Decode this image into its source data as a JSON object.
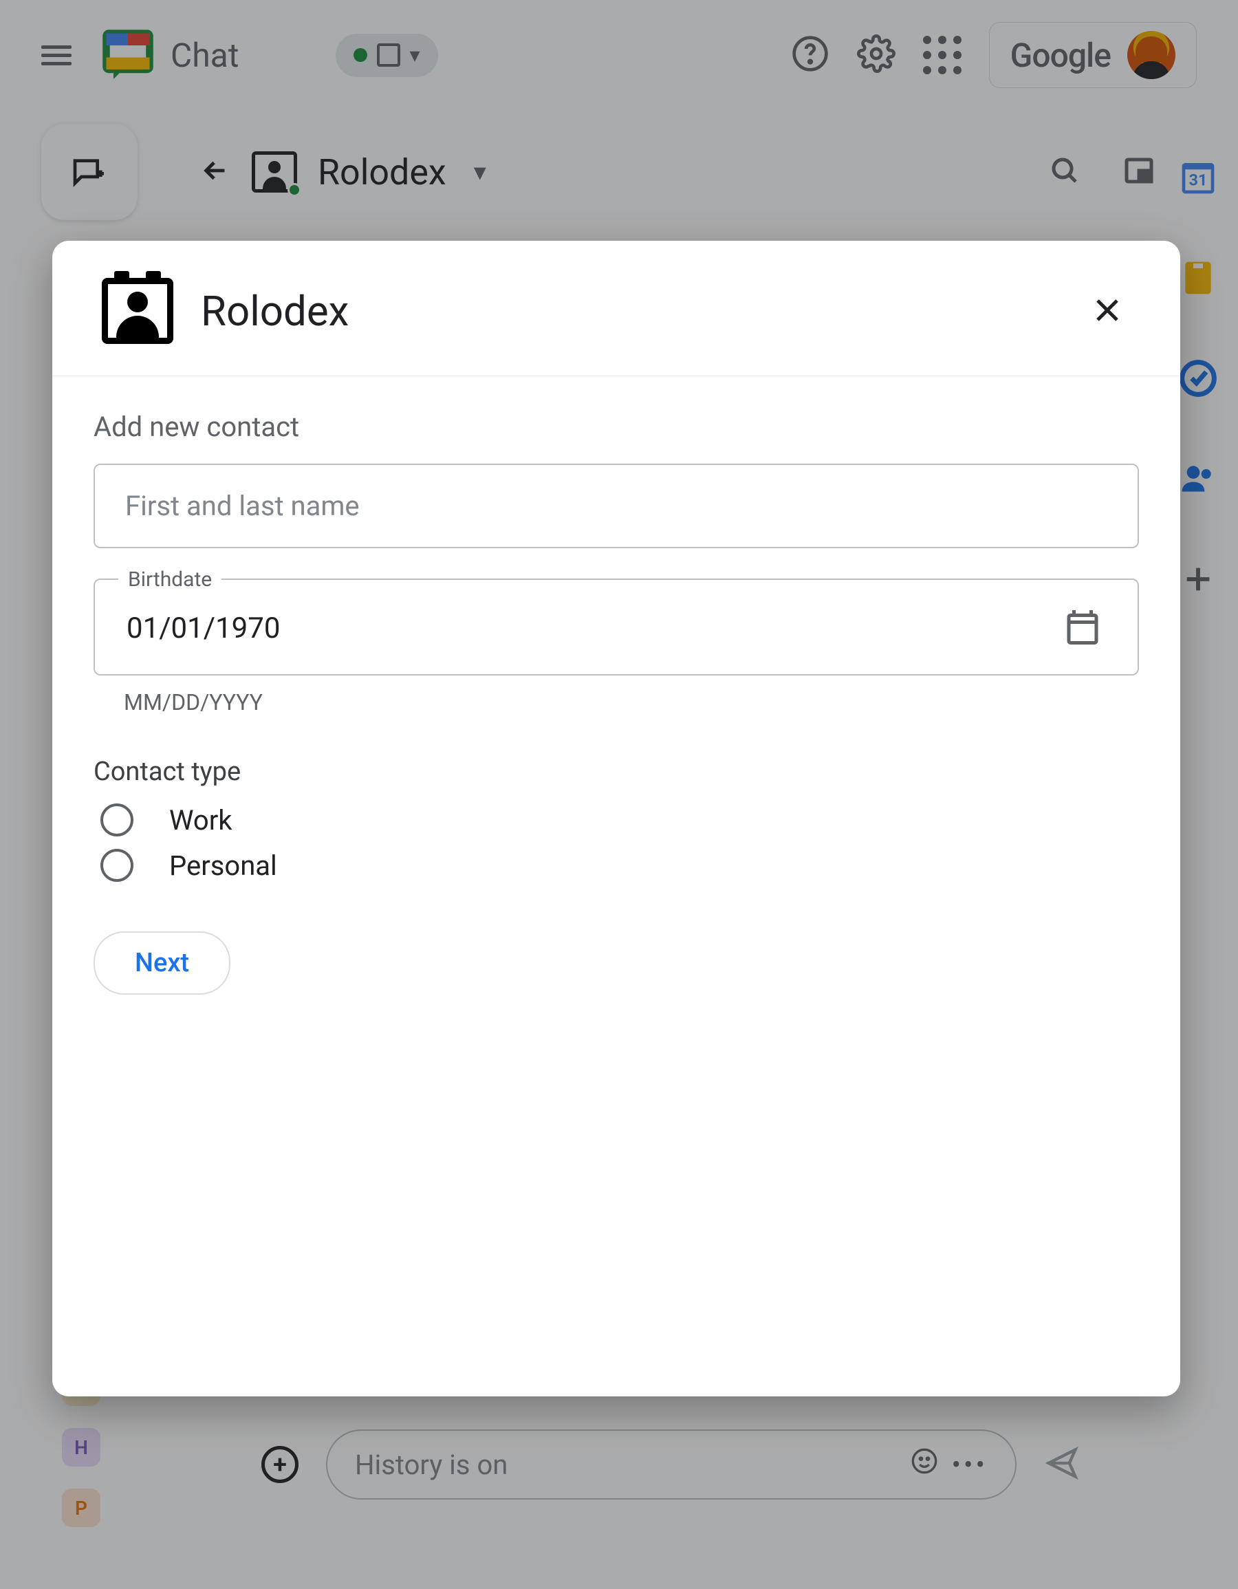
{
  "header": {
    "product": "Chat",
    "google_label": "Google"
  },
  "space": {
    "name": "Rolodex",
    "calendar_badge": "31"
  },
  "compose": {
    "placeholder": "History is on"
  },
  "side_chips": [
    "H",
    "P"
  ],
  "dialog": {
    "title": "Rolodex",
    "section_title": "Add new contact",
    "name_placeholder": "First and last name",
    "birthdate_label": "Birthdate",
    "birthdate_value": "01/01/1970",
    "birthdate_helper": "MM/DD/YYYY",
    "contact_type_label": "Contact type",
    "contact_types": [
      "Work",
      "Personal"
    ],
    "next_label": "Next"
  }
}
